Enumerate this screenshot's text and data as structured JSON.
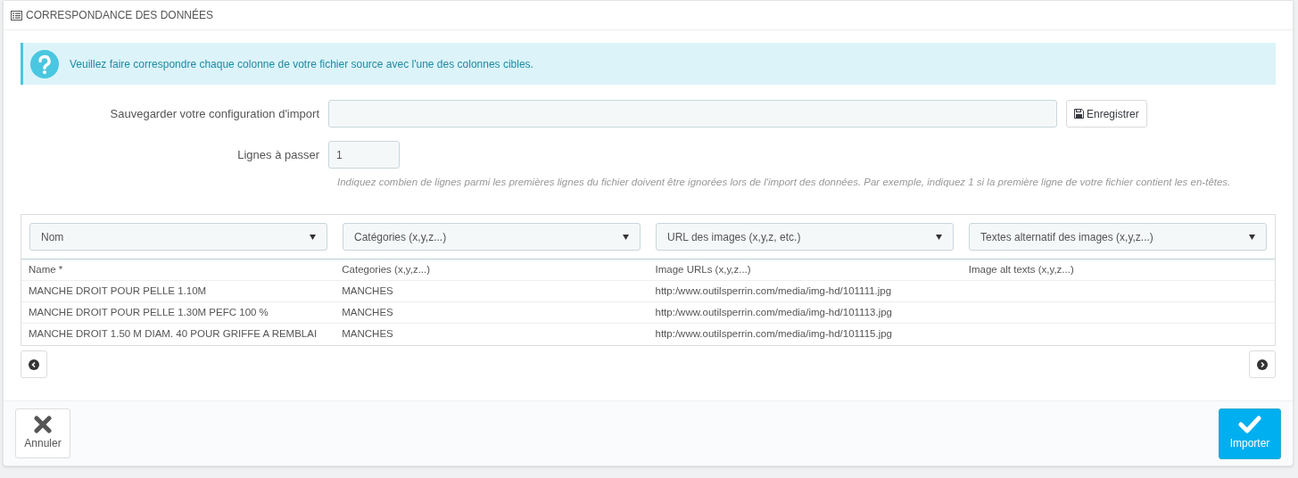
{
  "panel": {
    "title": "CORRESPONDANCE DES DONNÉES"
  },
  "alert": {
    "text": "Veuillez faire correspondre chaque colonne de votre fichier source avec l'une des colonnes cibles."
  },
  "form": {
    "config_label": "Sauvegarder votre configuration d'import",
    "save_button": "Enregistrer",
    "skip_label": "Lignes à passer",
    "skip_value": "1",
    "help": "Indiquez combien de lignes parmi les premières lignes du fichier doivent être ignorées lors de l'import des données. Par exemple, indiquez 1 si la première ligne de votre fichier contient les en-têtes."
  },
  "table": {
    "selects": [
      "Nom",
      "Catégories (x,y,z...)",
      "URL des images (x,y,z, etc.)",
      "Textes alternatif des images (x,y,z...)"
    ],
    "columns": [
      "Name *",
      "Categories (x,y,z...)",
      "Image URLs (x,y,z...)",
      "Image alt texts (x,y,z...)"
    ],
    "rows": [
      [
        "MANCHE DROIT POUR PELLE 1.10M",
        "MANCHES",
        "http:/www.outilsperrin.com/media/img-hd/101111.jpg"
      ],
      [
        "MANCHE DROIT POUR PELLE 1.30M PEFC 100 %",
        "MANCHES",
        "http:/www.outilsperrin.com/media/img-hd/101113.jpg"
      ],
      [
        "MANCHE DROIT 1.50 M DIAM. 40 POUR GRIFFE A REMBLAI",
        "MANCHES",
        "http:/www.outilsperrin.com/media/img-hd/101115.jpg"
      ]
    ]
  },
  "footer": {
    "cancel_button": "Annuler",
    "import_button": "Importer"
  }
}
